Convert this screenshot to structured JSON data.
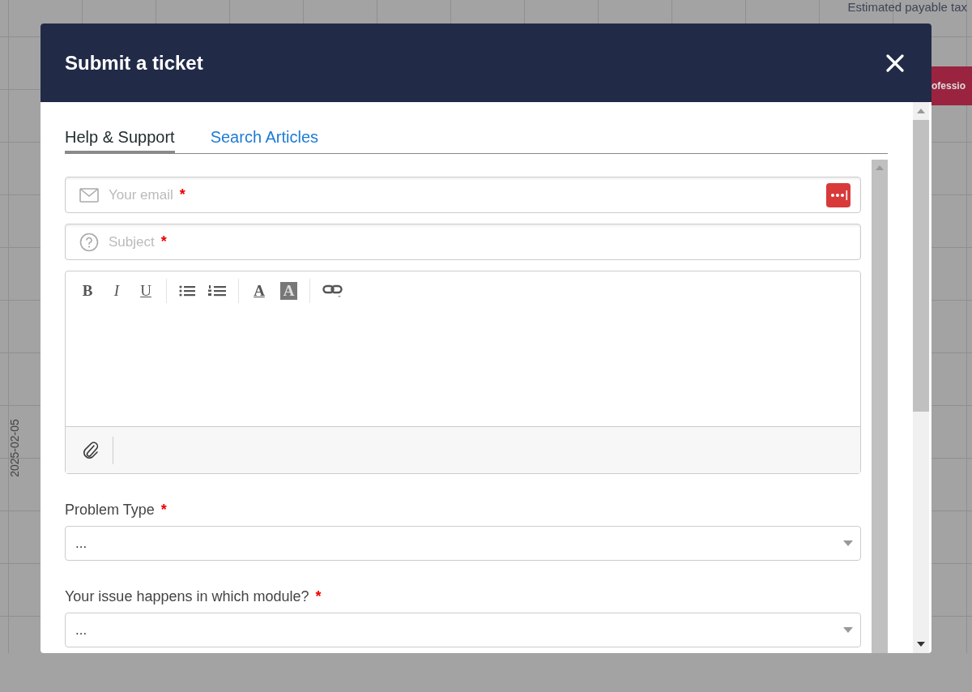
{
  "background": {
    "summary_label": "Estimated payable tax",
    "action_button": "ofessio",
    "axis_date": "2025-02-05"
  },
  "dialog": {
    "title": "Submit a ticket"
  },
  "tabs": [
    {
      "label": "Help & Support",
      "selected": true
    },
    {
      "label": "Search Articles",
      "selected": false
    }
  ],
  "required_mark": "*",
  "fields": [
    {
      "kind": "email",
      "placeholder": "Your email",
      "required": true
    },
    {
      "kind": "subject",
      "placeholder": "Subject",
      "required": true
    }
  ],
  "editor_toolbar": [
    {
      "kind": "bold",
      "text": "B"
    },
    {
      "kind": "italic",
      "text": "I"
    },
    {
      "kind": "underline",
      "text": "U"
    },
    {
      "kind": "bullets"
    },
    {
      "kind": "numbers"
    },
    {
      "kind": "color",
      "text": "A"
    },
    {
      "kind": "highlight",
      "text": "A"
    },
    {
      "kind": "link"
    }
  ],
  "selects": [
    {
      "label": "Problem Type",
      "required": true,
      "value": "..."
    },
    {
      "label": "Your issue happens in which module?",
      "required": true,
      "value": "..."
    }
  ]
}
